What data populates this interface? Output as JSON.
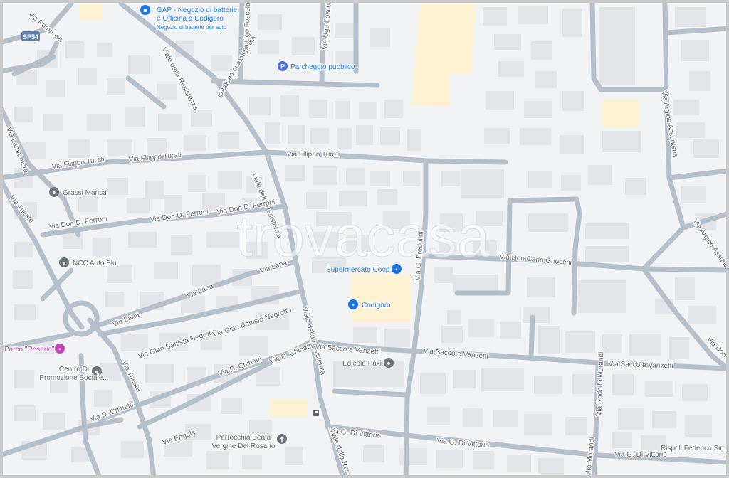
{
  "watermark": "trovacasa",
  "highway_shield": "SP54",
  "streets": [
    {
      "text": "Via Pomposa"
    },
    {
      "text": "Viale della Resistenza"
    },
    {
      "text": "Via Giacomo Leopardi"
    },
    {
      "text": "Via Ugo Foscolo"
    },
    {
      "text": "Via Filippo Turati"
    },
    {
      "text": "Via Filippo Turati"
    },
    {
      "text": "Via Filippo Turati"
    },
    {
      "text": "Viale della Resistenza"
    },
    {
      "text": "Via Don D. Ferroni"
    },
    {
      "text": "Via Don D. Ferroni"
    },
    {
      "text": "Via Don D. Ferroni"
    },
    {
      "text": "Via Trieste"
    },
    {
      "text": "Via Lana"
    },
    {
      "text": "Via Lana"
    },
    {
      "text": "Via Lana"
    },
    {
      "text": "Via Gian Battista Negrotto"
    },
    {
      "text": "Via Gian Battista Negrotto"
    },
    {
      "text": "Via D. Chinatti"
    },
    {
      "text": "Via D. Chinatti"
    },
    {
      "text": "Via D. Chinatti"
    },
    {
      "text": "Via Trieste"
    },
    {
      "text": "Via Engels"
    },
    {
      "text": "Viale della Resistenza"
    },
    {
      "text": "Via G. Bredolini"
    },
    {
      "text": "Via Don Carlo Gnocchi"
    },
    {
      "text": "Via Sacco e Vanzetti"
    },
    {
      "text": "Via Sacco e Vanzetti"
    },
    {
      "text": "Via Sacco e Vanzetti"
    },
    {
      "text": "Via G. Di Vittorio"
    },
    {
      "text": "Via G. Di Vittorio"
    },
    {
      "text": "Via G. Di Vittorio"
    },
    {
      "text": "Via Rodolfo Morandi"
    },
    {
      "text": "Via Rodolfo Morandi"
    },
    {
      "text": "Via Argine Assunteria"
    },
    {
      "text": "Via Argine Assunteria"
    },
    {
      "text": "Via Don"
    },
    {
      "text": "Viale della Resistenza"
    },
    {
      "text": "Via Lamarmora"
    },
    {
      "text": "Via Ugo Foscolo"
    }
  ],
  "pois": [
    {
      "label": "Parcheggio pubblico",
      "icon": "parking-icon",
      "color": "#4f6ed8"
    },
    {
      "label": "Supermercato Coop",
      "icon": "shopping-cart-icon",
      "color": "#1a73e8"
    },
    {
      "label": "Codigoro",
      "icon": "shopping-cart-icon",
      "color": "#1a73e8"
    },
    {
      "label": "Grassi Marisa",
      "icon": "place-icon",
      "color": "#70757a"
    },
    {
      "label": "NCC Auto Blu",
      "icon": "place-icon",
      "color": "#70757a"
    },
    {
      "label": "Parco \"Rosario\"",
      "icon": "park-icon",
      "color": "#c142b8"
    },
    {
      "label": "Edicola Paki",
      "icon": "place-icon",
      "color": "#70757a"
    },
    {
      "label": "Parrocchia Beata Vergine Del Rosario",
      "line1": "Parrocchia Beata",
      "line2": "Vergine Del Rosario",
      "icon": "church-icon",
      "color": "#70757a"
    },
    {
      "label": "Rispoli Federico Simon",
      "icon": "none",
      "color": "#70757a"
    },
    {
      "label": "Centro Di Promozione Sociale...",
      "line1": "Centro Di",
      "line2": "Promozione Sociale...",
      "icon": "place-icon",
      "color": "#70757a"
    },
    {
      "label": "GAP - Negozio di batterie e Officina a Codigoro",
      "line1": "GAP - Negozio di batterie",
      "line2": "e Officina a Codigoro",
      "line3": "Negozio di batterie per auto",
      "icon": "lock-icon",
      "color": "#1a73e8"
    }
  ],
  "colors": {
    "background": "#f1f3f4",
    "road": "#b5c0ca",
    "building": "#e3e5e8",
    "commercial": "#fdf3d3",
    "street_label": "#5f6368",
    "poi_blue": "#1a73e8"
  }
}
